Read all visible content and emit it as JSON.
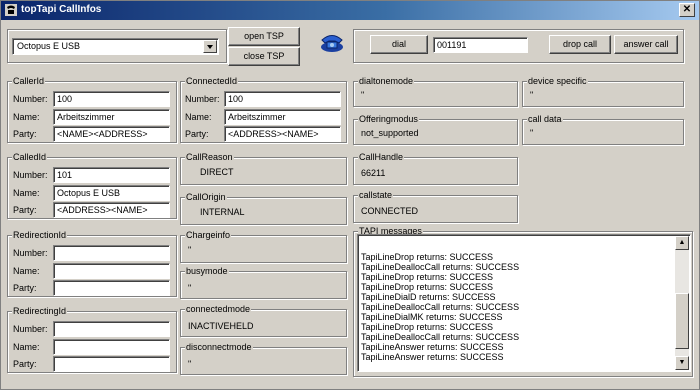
{
  "window": {
    "title": "topTapi CallInfos",
    "close_glyph": "✕"
  },
  "device_combo": {
    "selected": "Octopus E USB"
  },
  "toolbar": {
    "open_tsp": "open TSP",
    "close_tsp": "close TSP"
  },
  "dial": {
    "dial_label": "dial",
    "number": "001191",
    "drop_call": "drop call",
    "answer_call": "answer call"
  },
  "labels": {
    "number": "Number:",
    "name": "Name:",
    "party": "Party:"
  },
  "callerid": {
    "title": "CallerId",
    "number": "100",
    "name": "Arbeitszimmer",
    "party": "<NAME><ADDRESS>"
  },
  "connectedid": {
    "title": "ConnectedId",
    "number": "100",
    "name": "Arbeitszimmer",
    "party": "<ADDRESS><NAME>"
  },
  "calledid": {
    "title": "CalledId",
    "number": "101",
    "name": "Octopus E USB",
    "party": "<ADDRESS><NAME>"
  },
  "redirectionid": {
    "title": "RedirectionId",
    "number": "",
    "name": "",
    "party": ""
  },
  "redirectingid": {
    "title": "RedirectingId",
    "number": "",
    "name": "",
    "party": ""
  },
  "callreason": {
    "title": "CallReason",
    "value": "DIRECT"
  },
  "callorigin": {
    "title": "CallOrigin",
    "value": "INTERNAL"
  },
  "chargeinfo": {
    "title": "Chargeinfo",
    "value": "\""
  },
  "busymode": {
    "title": "busymode",
    "value": "\""
  },
  "connectedmode": {
    "title": "connectedmode",
    "value": "INACTIVEHELD"
  },
  "disconnectmode": {
    "title": "disconnectmode",
    "value": "\""
  },
  "dialtonemode": {
    "title": "dialtonemode",
    "value": "\""
  },
  "device_specific": {
    "title": "device specific",
    "value": "\""
  },
  "offeringmodus": {
    "title": "Offeringmodus",
    "value": "not_supported"
  },
  "call_data": {
    "title": "call data",
    "value": "\""
  },
  "callhandle": {
    "title": "CallHandle",
    "value": "66211"
  },
  "callstate": {
    "title": "callstate",
    "value": "CONNECTED"
  },
  "tapi_messages": {
    "title": "TAPI messages",
    "lines": [
      "TapiLineDrop returns:  SUCCESS",
      "TapiLineDeallocCall returns:  SUCCESS",
      "TapiLineDrop returns:  SUCCESS",
      "TapiLineDrop returns:  SUCCESS",
      "TapiLineDialD returns:  SUCCESS",
      "TapiLineDeallocCall returns:  SUCCESS",
      "TapiLineDialMK returns:  SUCCESS",
      "TapiLineDrop returns:  SUCCESS",
      "TapiLineDeallocCall returns:  SUCCESS",
      "TapiLineAnswer returns:  SUCCESS",
      "TapiLineAnswer returns:  SUCCESS"
    ]
  },
  "icons": {
    "app": "phone-icon",
    "tsp": "telephone-icon"
  },
  "colors": {
    "titlebar_start": "#0a246a",
    "titlebar_end": "#a6caf0",
    "window_bg": "#d4d0c8"
  }
}
